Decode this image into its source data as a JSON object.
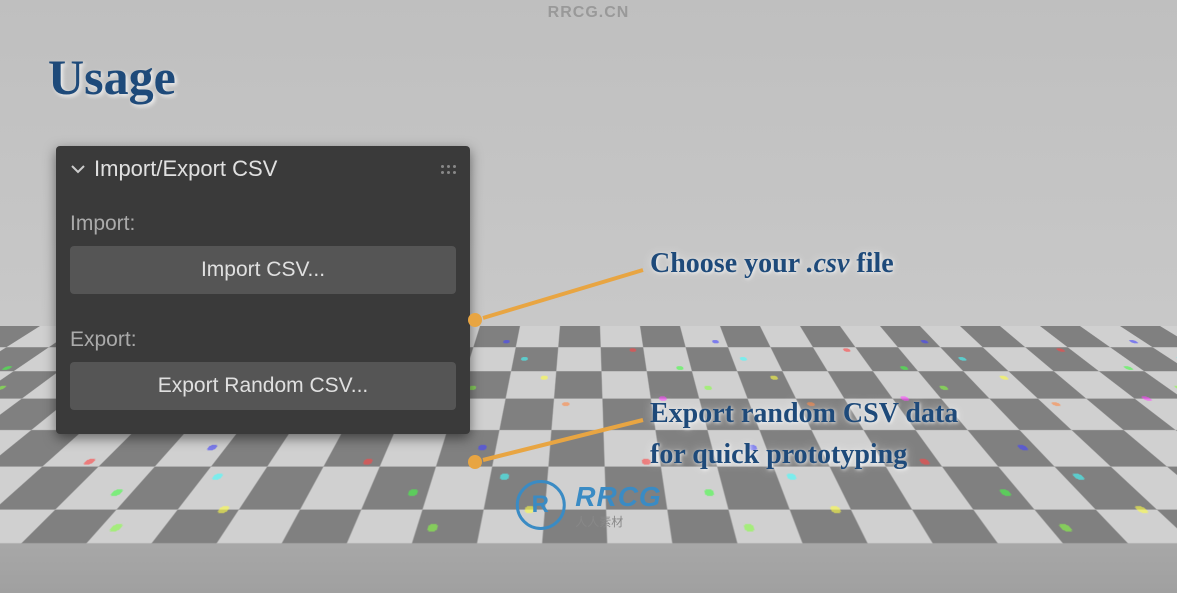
{
  "title": "Usage",
  "watermark_text": "RRCG.CN",
  "panel": {
    "header": "Import/Export CSV",
    "import_label": "Import:",
    "import_button": "Import CSV...",
    "export_label": "Export:",
    "export_button": "Export Random CSV..."
  },
  "annotations": {
    "choose_file_pre": "Choose your ",
    "choose_file_em": ".csv",
    "choose_file_post": " file",
    "export_line1": "Export random CSV data",
    "export_line2": "for quick prototyping"
  },
  "logo": {
    "main": "RRCG",
    "sub": "人人素材"
  }
}
